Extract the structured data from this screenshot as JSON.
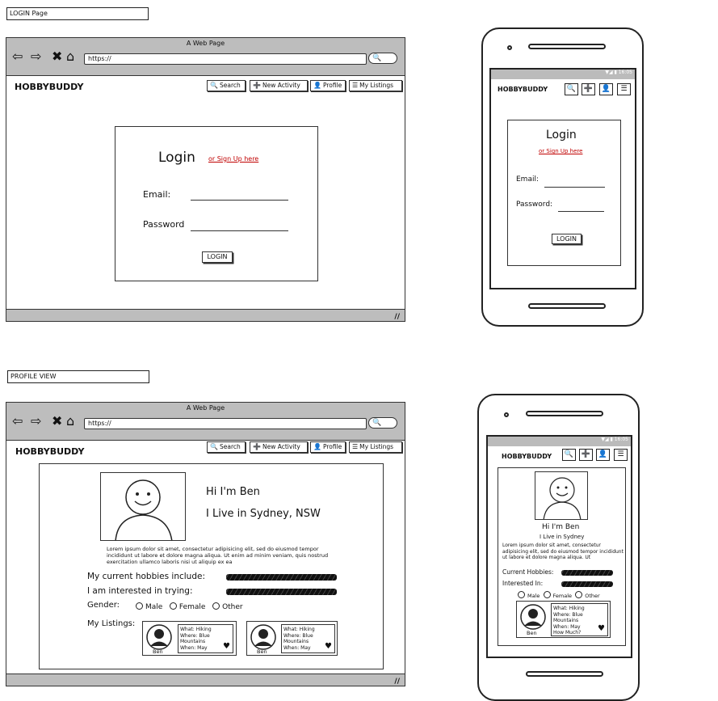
{
  "login_label": "LOGIN Page",
  "profile_label": "PROFILE VIEW",
  "browser": {
    "window_title": "A Web Page",
    "url": "https://",
    "brand": "HOBBYBUDDY",
    "nav": [
      {
        "label": "Search",
        "icon": "search-icon"
      },
      {
        "label": "New Activity",
        "icon": "plus-icon"
      },
      {
        "label": "Profile",
        "icon": "user-icon"
      },
      {
        "label": "My Listings",
        "icon": "list-icon"
      }
    ]
  },
  "login": {
    "title": "Login",
    "signup_link": "or Sign Up here",
    "email_label": "Email:",
    "password_label": "Password",
    "mobile_password_label": "Password:",
    "button": "LOGIN"
  },
  "phone": {
    "time": "16:05"
  },
  "profile": {
    "greeting": "Hi I'm Ben",
    "location": "I Live in Sydney, NSW",
    "mobile_location": "I Live in Sydney",
    "bio": "Lorem ipsum dolor sit amet, consectetur adipisicing elit, sed do eiusmod tempor incididunt ut labore et dolore magna aliqua. Ut enim ad minim veniam, quis nostrud exercitation ullamco laboris nisi ut aliquip ex ea",
    "mobile_bio": "Lorem ipsum dolor sit amet, consectetur adipisicing elit, sed do eiusmod tempor incididunt ut labore et dolore magna aliqua. Ut",
    "hobbies_label": "My current hobbies include:",
    "interested_label": "I am interested in trying:",
    "mobile_hobbies_label": "Current Hobbies:",
    "mobile_interested_label": "Interested In:",
    "gender_label": "Gender:",
    "gender_options": [
      "Male",
      "Female",
      "Other"
    ],
    "listings_label": "My Listings:",
    "listing": {
      "name": "Ben",
      "what": "What: Hiking",
      "where": "Where: Blue Mountains",
      "when": "When: May",
      "how_much": "How Much?"
    }
  }
}
